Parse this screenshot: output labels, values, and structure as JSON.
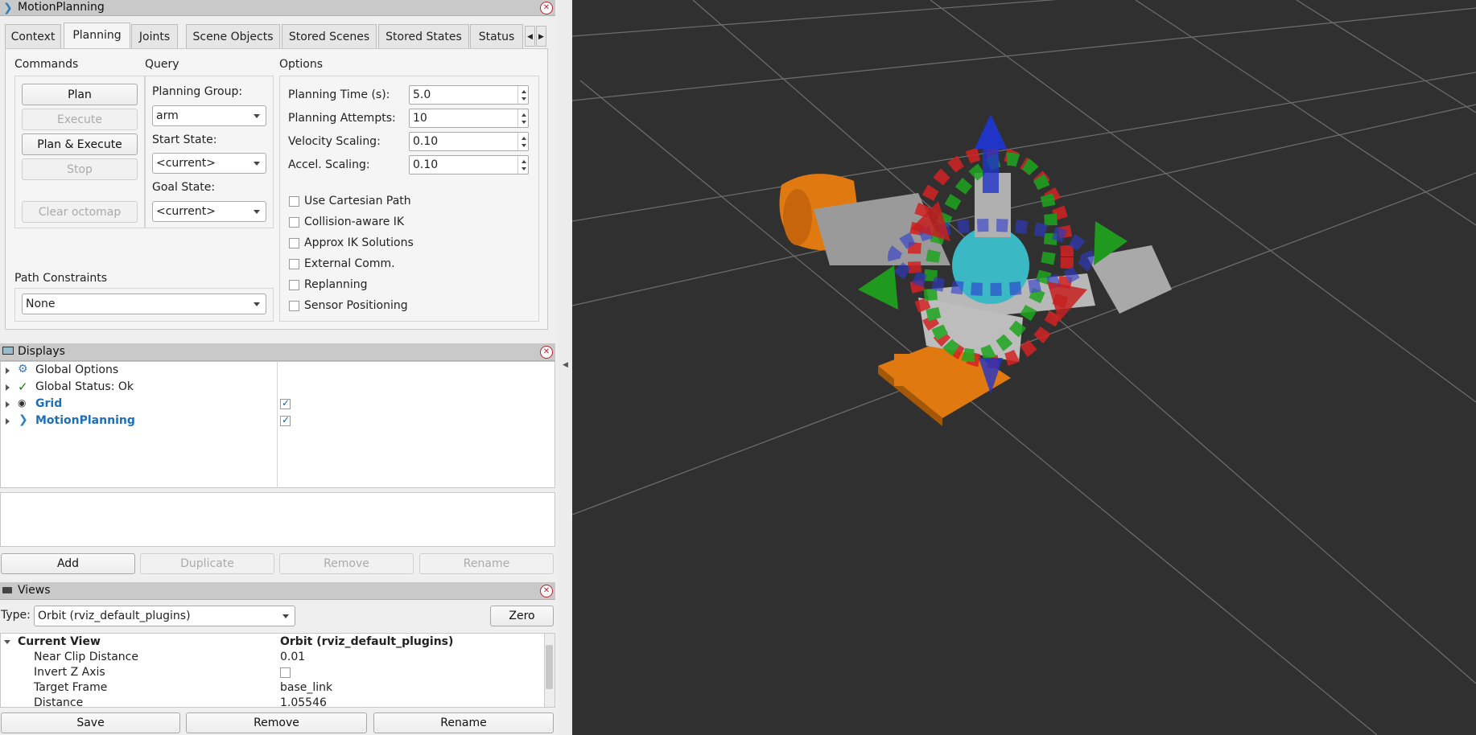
{
  "motion_planning": {
    "title": "MotionPlanning",
    "close": "x",
    "tabs": [
      "Context",
      "Planning",
      "Joints",
      "Scene Objects",
      "Stored Scenes",
      "Stored States",
      "Status"
    ],
    "commands": {
      "header": "Commands",
      "plan": "Plan",
      "execute": "Execute",
      "plan_execute": "Plan & Execute",
      "stop": "Stop",
      "clear_octomap": "Clear octomap"
    },
    "query": {
      "header": "Query",
      "planning_group_label": "Planning Group:",
      "planning_group_value": "arm",
      "start_state_label": "Start State:",
      "start_state_value": "<current>",
      "goal_state_label": "Goal State:",
      "goal_state_value": "<current>"
    },
    "options": {
      "header": "Options",
      "planning_time_label": "Planning Time (s):",
      "planning_time_value": "5.0",
      "planning_attempts_label": "Planning Attempts:",
      "planning_attempts_value": "10",
      "velocity_scaling_label": "Velocity Scaling:",
      "velocity_scaling_value": "0.10",
      "accel_scaling_label": "Accel. Scaling:",
      "accel_scaling_value": "0.10",
      "checkboxes": [
        "Use Cartesian Path",
        "Collision-aware IK",
        "Approx IK Solutions",
        "External Comm.",
        "Replanning",
        "Sensor Positioning"
      ]
    },
    "path_constraints": {
      "label": "Path Constraints",
      "value": "None"
    }
  },
  "displays": {
    "title": "Displays",
    "items": [
      {
        "label": "Global Options",
        "icon": "gear-icon"
      },
      {
        "label": "Global Status: Ok",
        "icon": "check-icon"
      },
      {
        "label": "Grid",
        "icon": "grid-icon"
      },
      {
        "label": "MotionPlanning",
        "icon": "motion-planning-icon"
      }
    ],
    "buttons": {
      "add": "Add",
      "duplicate": "Duplicate",
      "remove": "Remove",
      "rename": "Rename"
    }
  },
  "views": {
    "title": "Views",
    "type_label": "Type:",
    "type_value": "Orbit (rviz_default_plugins)",
    "zero": "Zero",
    "current_view": {
      "label": "Current View",
      "value": "Orbit (rviz_default_plugins)"
    },
    "props": [
      {
        "label": "Near Clip Distance",
        "value": "0.01"
      },
      {
        "label": "Invert Z Axis",
        "value": ""
      },
      {
        "label": "Target Frame",
        "value": "base_link"
      },
      {
        "label": "Distance",
        "value": "1.05546"
      }
    ],
    "buttons": {
      "save": "Save",
      "remove": "Remove",
      "rename": "Rename"
    }
  },
  "colors": {
    "viewport_bg": "#303030",
    "grid_line": "#6e6e6e",
    "link_blue": "#1d6fb8",
    "robot_orange": "#e07a10"
  }
}
